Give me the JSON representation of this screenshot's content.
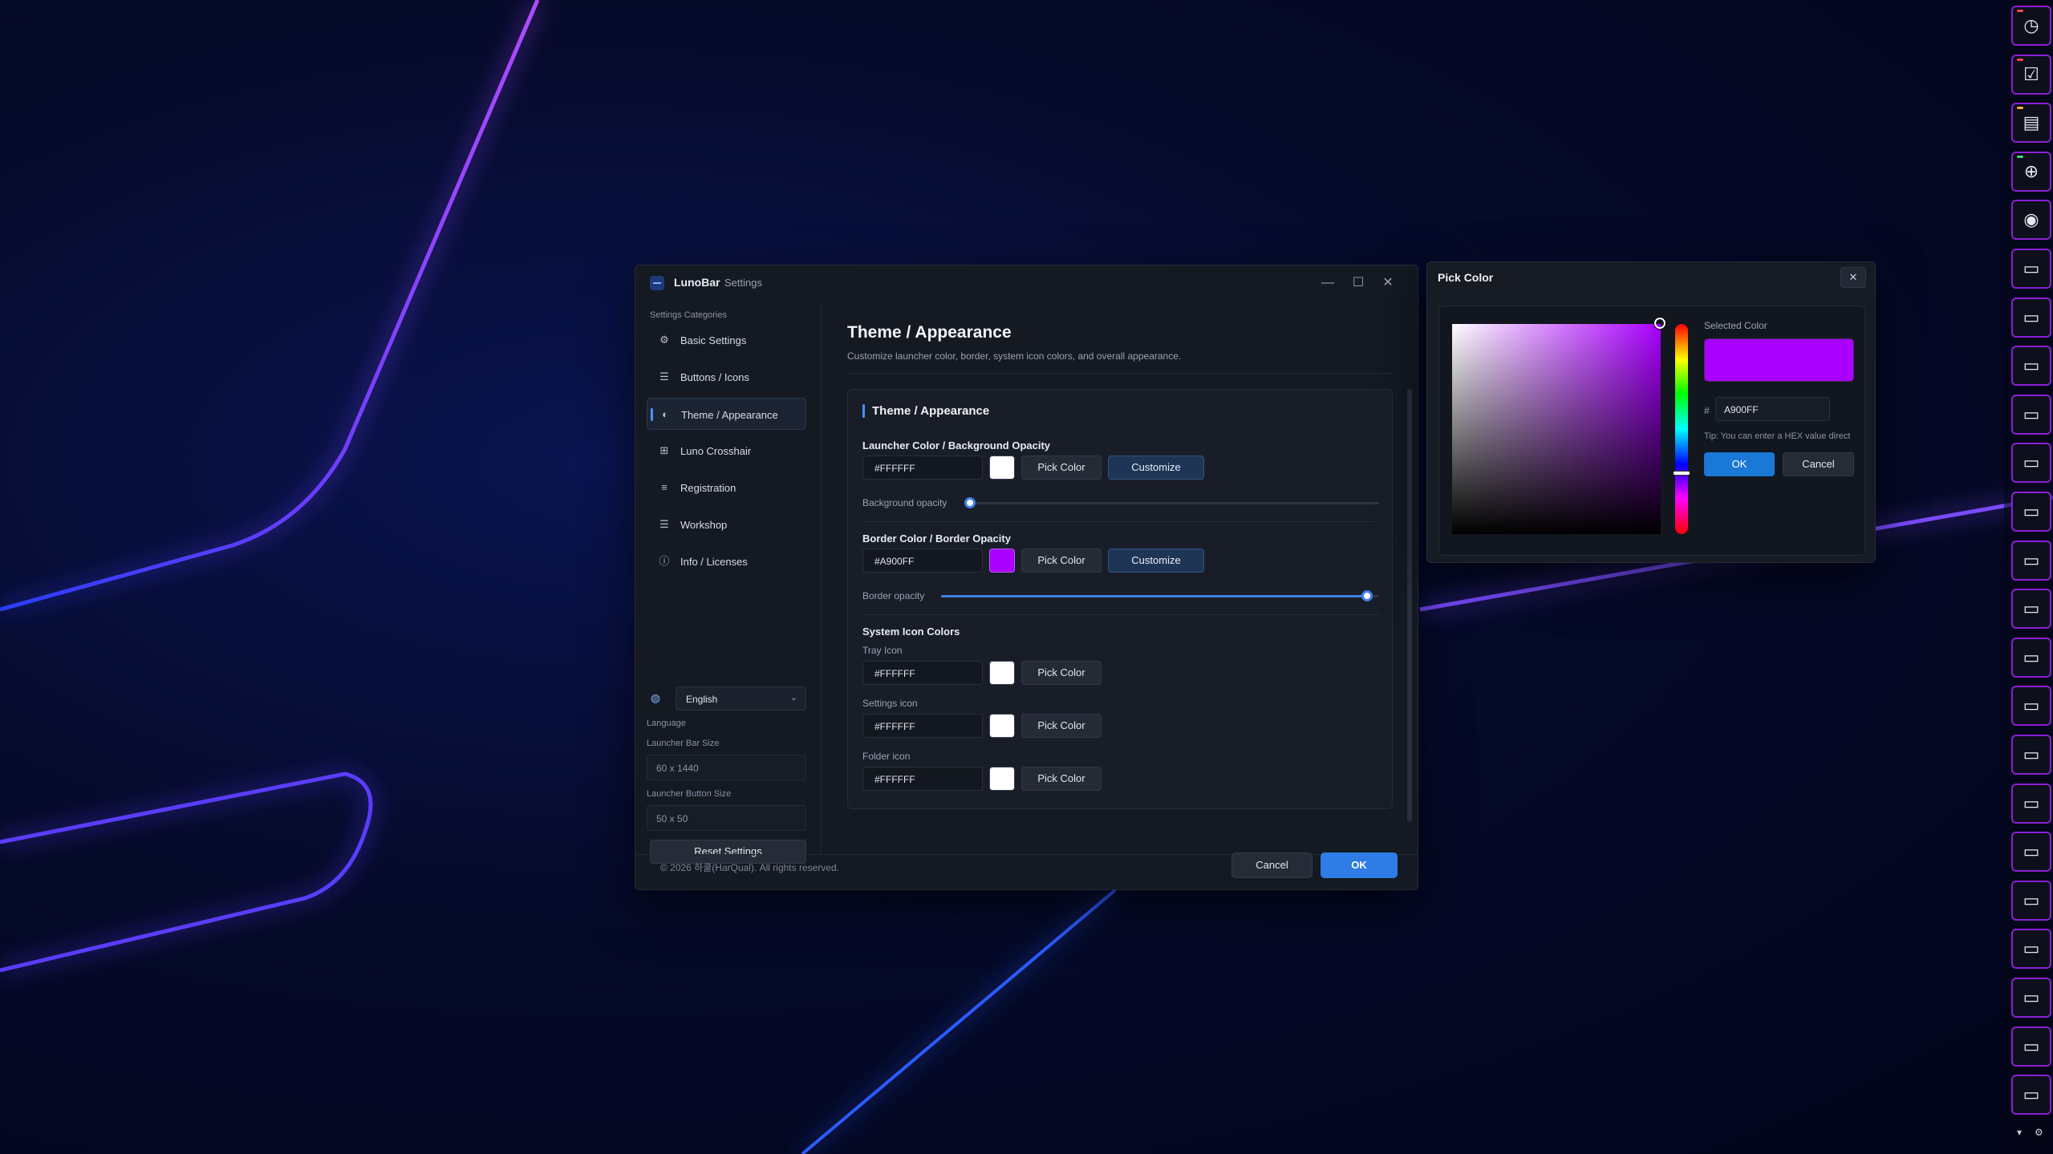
{
  "colors": {
    "accent": "#2E7CE6",
    "launcher_border": "#A900FF",
    "selected": "#A900FF",
    "white": "#FFFFFF"
  },
  "settings_window": {
    "app_name": "LunoBar",
    "app_subtitle": "Settings",
    "controls": {
      "minimize": "—",
      "maximize": "☐",
      "close": "✕"
    },
    "sidebar": {
      "caption": "Settings Categories",
      "items": [
        {
          "label": "Basic Settings",
          "icon": "gear-icon",
          "glyph": "⚙",
          "active": false
        },
        {
          "label": "Buttons / Icons",
          "icon": "list-icon",
          "glyph": "☰",
          "active": false
        },
        {
          "label": "Theme / Appearance",
          "icon": "palette-icon",
          "glyph": "◐",
          "active": true
        },
        {
          "label": "Luno Crosshair",
          "icon": "gamepad-icon",
          "glyph": "⊞",
          "active": false
        },
        {
          "label": "Registration",
          "icon": "list-numbered-icon",
          "glyph": "≡",
          "active": false
        },
        {
          "label": "Workshop",
          "icon": "list-icon",
          "glyph": "☰",
          "active": false
        },
        {
          "label": "Info / Licenses",
          "icon": "info-icon",
          "glyph": "ⓘ",
          "active": false
        }
      ],
      "language": {
        "value": "English",
        "label": "Language"
      },
      "launcher_bar_size": {
        "label": "Launcher Bar Size",
        "value": "60 x 1440"
      },
      "launcher_button_size": {
        "label": "Launcher Button Size",
        "value": "50 x 50"
      },
      "reset_label": "Reset Settings"
    },
    "content": {
      "title": "Theme / Appearance",
      "description": "Customize launcher color, border, system icon colors, and overall appearance.",
      "card_title": "Theme / Appearance",
      "launcher_color": {
        "title": "Launcher Color / Background Opacity",
        "hex": "#FFFFFF",
        "pick_label": "Pick Color",
        "customize_label": "Customize",
        "slider_label": "Background opacity",
        "slider_value": 0.0
      },
      "border_color": {
        "title": "Border Color / Border Opacity",
        "hex": "#A900FF",
        "pick_label": "Pick Color",
        "customize_label": "Customize",
        "slider_label": "Border opacity",
        "slider_value": 1.0
      },
      "system_icons": {
        "title": "System Icon Colors",
        "tray": {
          "label": "Tray Icon",
          "hex": "#FFFFFF",
          "pick_label": "Pick Color"
        },
        "settings": {
          "label": "Settings icon",
          "hex": "#FFFFFF",
          "pick_label": "Pick Color"
        },
        "folder": {
          "label": "Folder icon",
          "hex": "#FFFFFF",
          "pick_label": "Pick Color"
        }
      }
    },
    "footer": {
      "copyright": "© 2026 하쿨(HarQual). All rights reserved.",
      "cancel_label": "Cancel",
      "ok_label": "OK"
    }
  },
  "pick_color_dialog": {
    "title": "Pick Color",
    "close": "✕",
    "selected_label": "Selected Color",
    "hash": "#",
    "hex_value": "A900FF",
    "tip": "Tip: You can enter a HEX value direct",
    "ok_label": "OK",
    "cancel_label": "Cancel"
  },
  "launcher_bar": {
    "buttons": [
      {
        "icon": "clock-icon",
        "glyph": "◷",
        "accent": "#ff4a4a"
      },
      {
        "icon": "checklist-icon",
        "glyph": "☑",
        "accent": "#ff4a4a"
      },
      {
        "icon": "document-icon",
        "glyph": "▤",
        "accent": "#ffb13b"
      },
      {
        "icon": "crosshair-icon",
        "glyph": "⊕",
        "accent": "#3be07a"
      },
      {
        "icon": "luno-app-icon",
        "glyph": "◉",
        "accent": ""
      },
      {
        "icon": "folder-icon",
        "glyph": "▭",
        "accent": ""
      },
      {
        "icon": "folder-icon",
        "glyph": "▭",
        "accent": ""
      },
      {
        "icon": "folder-icon",
        "glyph": "▭",
        "accent": ""
      },
      {
        "icon": "folder-icon",
        "glyph": "▭",
        "accent": ""
      },
      {
        "icon": "folder-icon",
        "glyph": "▭",
        "accent": ""
      },
      {
        "icon": "folder-icon",
        "glyph": "▭",
        "accent": ""
      },
      {
        "icon": "folder-icon",
        "glyph": "▭",
        "accent": ""
      },
      {
        "icon": "folder-icon",
        "glyph": "▭",
        "accent": ""
      },
      {
        "icon": "folder-icon",
        "glyph": "▭",
        "accent": ""
      },
      {
        "icon": "folder-icon",
        "glyph": "▭",
        "accent": ""
      },
      {
        "icon": "folder-icon",
        "glyph": "▭",
        "accent": ""
      },
      {
        "icon": "folder-icon",
        "glyph": "▭",
        "accent": ""
      },
      {
        "icon": "folder-icon",
        "glyph": "▭",
        "accent": ""
      },
      {
        "icon": "folder-icon",
        "glyph": "▭",
        "accent": ""
      },
      {
        "icon": "folder-icon",
        "glyph": "▭",
        "accent": ""
      },
      {
        "icon": "folder-icon",
        "glyph": "▭",
        "accent": ""
      },
      {
        "icon": "folder-icon",
        "glyph": "▭",
        "accent": ""
      },
      {
        "icon": "folder-icon",
        "glyph": "▭",
        "accent": ""
      }
    ],
    "bottom_chevron": "▾",
    "bottom_gear": "⚙"
  }
}
